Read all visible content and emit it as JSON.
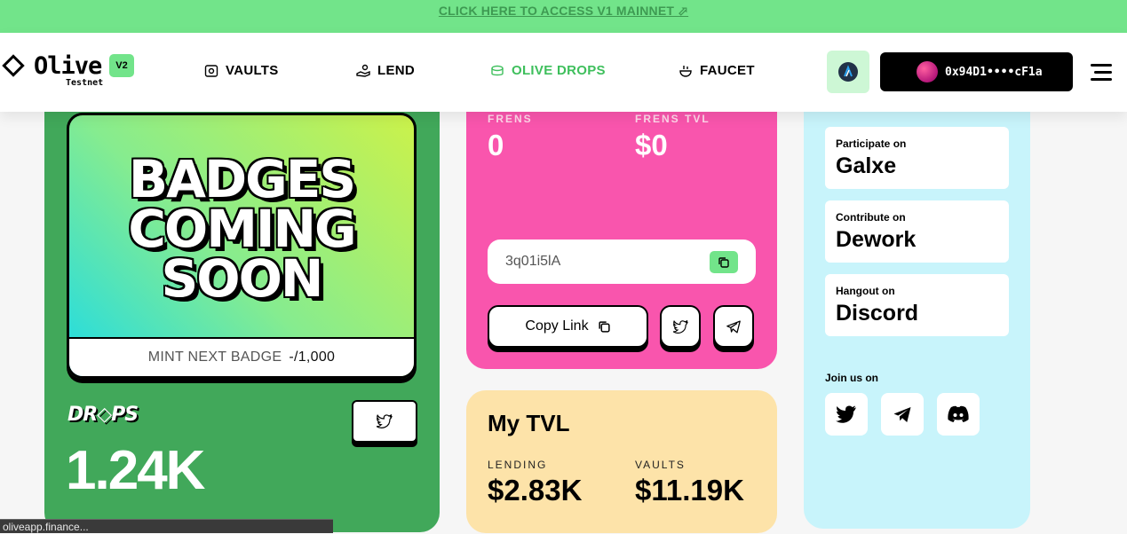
{
  "banner": {
    "text": "CLICK HERE TO ACCESS V1 MAINNET ⬀"
  },
  "header": {
    "logo": {
      "name": "Olive",
      "sub": "Testnet",
      "version": "V2"
    },
    "nav": [
      {
        "label": "VAULTS",
        "icon": "vault-icon",
        "active": false
      },
      {
        "label": "LEND",
        "icon": "lend-icon",
        "active": false
      },
      {
        "label": "OLIVE DROPS",
        "icon": "drops-icon",
        "active": true
      },
      {
        "label": "FAUCET",
        "icon": "faucet-icon",
        "active": false
      }
    ],
    "network_icon": "arbitrum-icon",
    "wallet": {
      "address": "0x94D1••••cF1a"
    },
    "menu_icon": "hamburger-icon"
  },
  "badge_card": {
    "image_text": [
      "BADGES",
      "COMING",
      "SOON"
    ],
    "mint_label": "MINT NEXT BADGE",
    "mint_count": "-/1,000",
    "drops_logo": "DR◇PS",
    "drops_total": "1.24K"
  },
  "referral_card": {
    "frens_label": "FRENS",
    "frens_value": "0",
    "frens_tvl_label": "FRENS TVL",
    "frens_tvl_value": "$0",
    "code": "3q01i5lA",
    "copy_link_label": "Copy Link"
  },
  "tvl_card": {
    "title": "My TVL",
    "lending_label": "LENDING",
    "lending_value": "$2.83K",
    "vaults_label": "VAULTS",
    "vaults_value": "$11.19K"
  },
  "community_card": {
    "links": [
      {
        "small": "Participate on",
        "big": "Galxe"
      },
      {
        "small": "Contribute on",
        "big": "Dework"
      },
      {
        "small": "Hangout on",
        "big": "Discord"
      }
    ],
    "join_label": "Join us on",
    "socials": [
      "twitter-icon",
      "telegram-icon",
      "discord-icon"
    ]
  },
  "status_bar": {
    "text": "oliveapp.finance..."
  }
}
